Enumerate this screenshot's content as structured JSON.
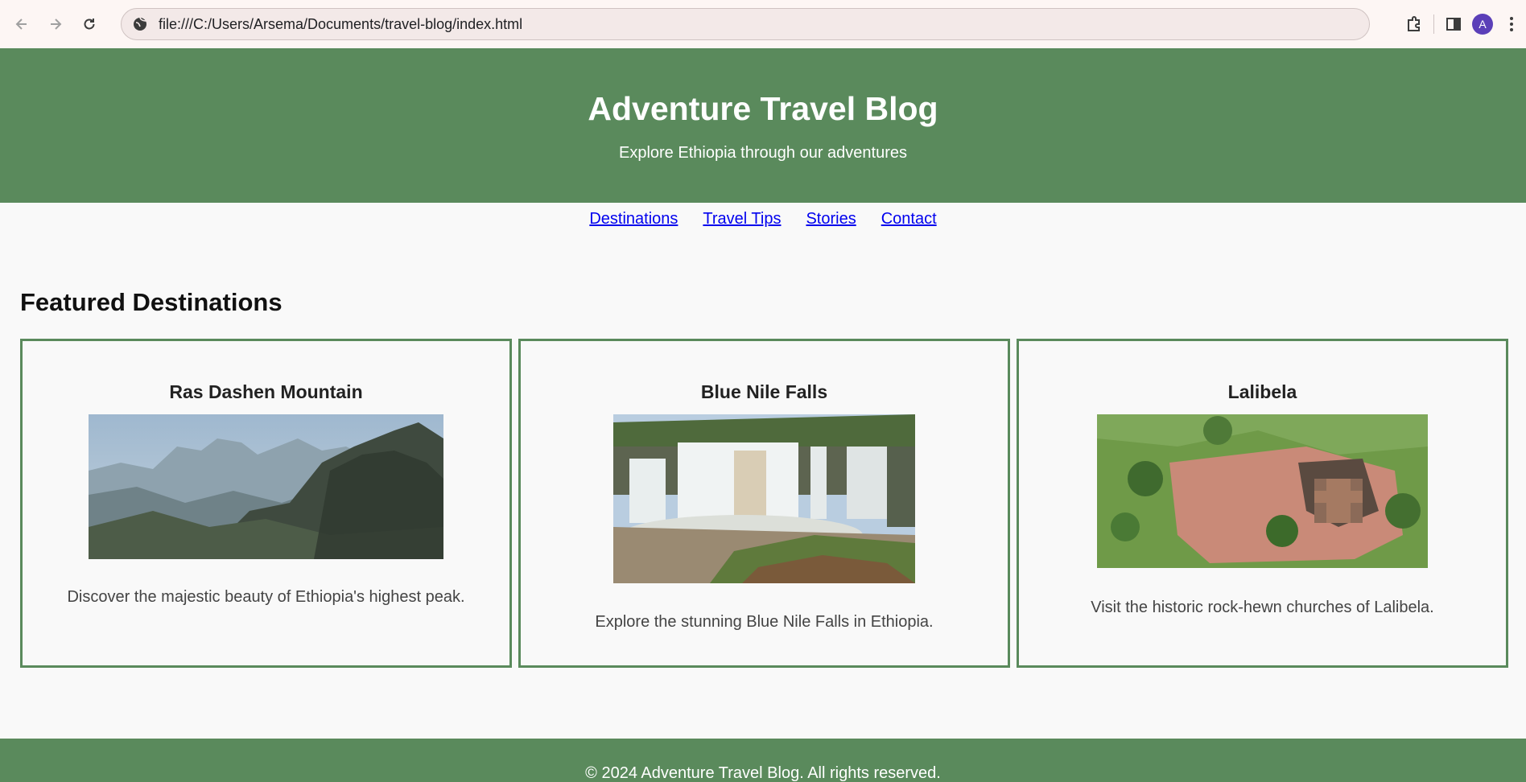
{
  "browser": {
    "url": "file:///C:/Users/Arsema/Documents/travel-blog/index.html",
    "avatar_letter": "A"
  },
  "header": {
    "title": "Adventure Travel Blog",
    "tagline": "Explore Ethiopia through our adventures"
  },
  "nav": {
    "items": [
      {
        "label": "Destinations"
      },
      {
        "label": "Travel Tips"
      },
      {
        "label": "Stories"
      },
      {
        "label": "Contact"
      }
    ]
  },
  "main": {
    "section_title": "Featured Destinations",
    "cards": [
      {
        "title": "Ras Dashen Mountain",
        "description": "Discover the majestic beauty of Ethiopia's highest peak."
      },
      {
        "title": "Blue Nile Falls",
        "description": "Explore the stunning Blue Nile Falls in Ethiopia."
      },
      {
        "title": "Lalibela",
        "description": "Visit the historic rock-hewn churches of Lalibela."
      }
    ]
  },
  "footer": {
    "text": "© 2024 Adventure Travel Blog. All rights reserved."
  },
  "colors": {
    "brand_green": "#5a8a5c",
    "link": "#0000ee",
    "page_bg": "#f9f9f9"
  }
}
